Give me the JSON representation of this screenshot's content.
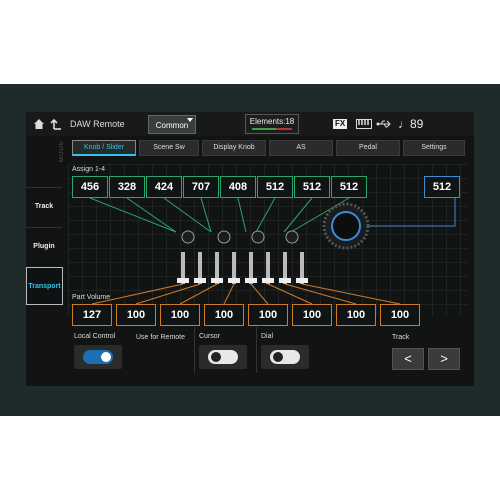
{
  "header": {
    "title": "DAW Remote",
    "common_label": "Common",
    "elements_label": "Elements:18",
    "fx_label": "FX",
    "tempo": "♩89"
  },
  "sidebar": {
    "mode_label": "MODE",
    "items": [
      {
        "label": "Track",
        "active": false
      },
      {
        "label": "Plugin",
        "active": false
      },
      {
        "label": "Transport",
        "active": true
      }
    ]
  },
  "tabs": [
    {
      "label": "Knob / Slider",
      "active": true
    },
    {
      "label": "Scene Sw",
      "active": false
    },
    {
      "label": "Display Knob",
      "active": false
    },
    {
      "label": "AS",
      "active": false
    },
    {
      "label": "Pedal",
      "active": false
    },
    {
      "label": "Settings",
      "active": false
    }
  ],
  "assign": {
    "label": "Assign 1-4",
    "values": [
      "456",
      "328",
      "424",
      "707",
      "408",
      "512",
      "512",
      "512",
      "512"
    ]
  },
  "part_volume": {
    "label": "Part Volume",
    "values": [
      "127",
      "100",
      "100",
      "100",
      "100",
      "100",
      "100",
      "100"
    ]
  },
  "controls": {
    "local_control": {
      "label": "Local Control",
      "on": true
    },
    "use_for_remote": {
      "label": "Use for Remote"
    },
    "cursor": {
      "label": "Cursor",
      "on": false
    },
    "dial": {
      "label": "Dial",
      "on": false
    },
    "track": {
      "label": "Track",
      "prev": "<",
      "next": ">"
    }
  },
  "colors": {
    "accent": "#2ec6ee",
    "assign_border": "#2aa56c",
    "volume_border": "#d07a28",
    "toggle_on": "#1c6fb4"
  }
}
